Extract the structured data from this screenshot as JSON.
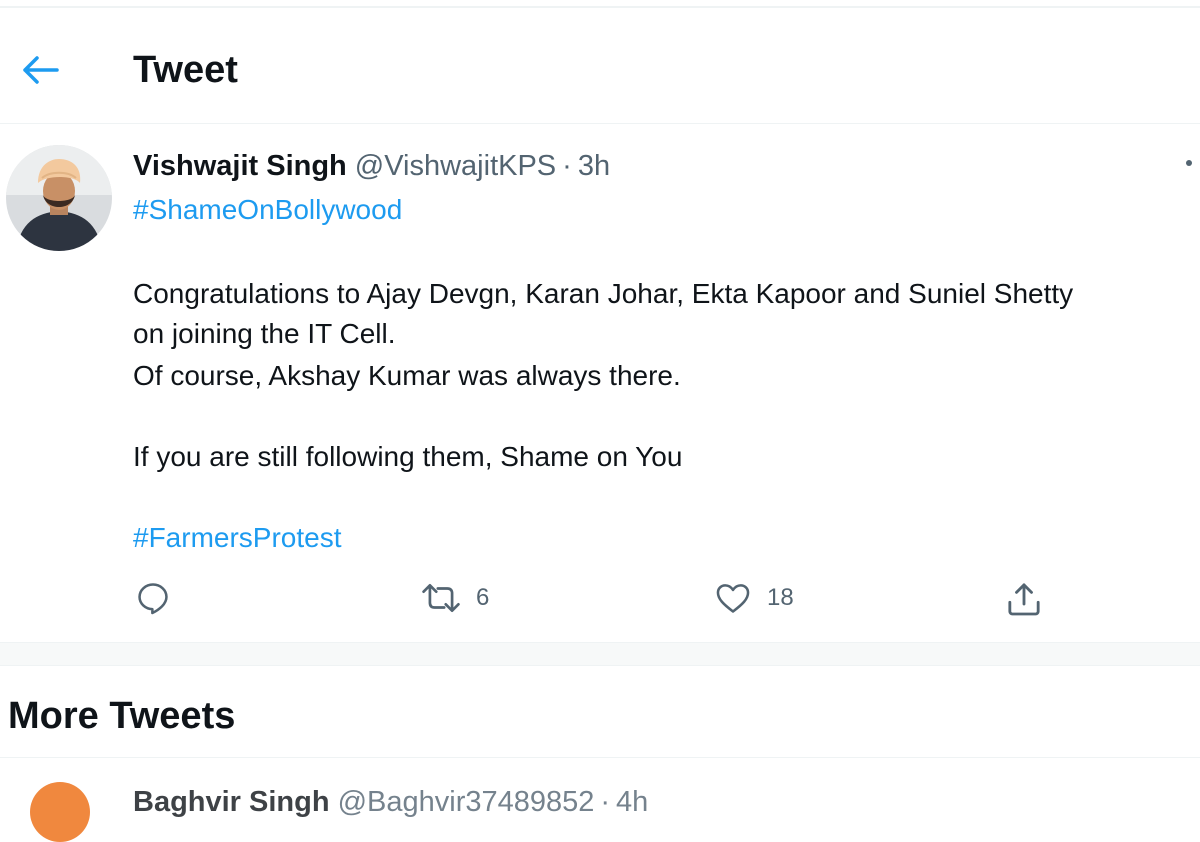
{
  "header": {
    "title": "Tweet",
    "back_icon": "arrow-left-icon"
  },
  "colors": {
    "accent": "#1d9bf0",
    "text": "#0f1419",
    "secondary": "#536471",
    "divider": "#eff3f4"
  },
  "tweet": {
    "author": {
      "display_name": "Vishwajit Singh",
      "handle": "@VishwajitKPS",
      "separator": "·",
      "time": "3h"
    },
    "lines": {
      "hashtag_top": "#ShameOnBollywood",
      "line1": "Congratulations to Ajay Devgn, Karan Johar, Ekta Kapoor and Suniel Shetty",
      "line2": "on joining the IT Cell.",
      "line3": "Of course, Akshay Kumar was always there.",
      "line4": "If you are still following them, Shame on You",
      "hashtag_bottom": "#FarmersProtest"
    },
    "actions": {
      "reply": {
        "icon": "reply-icon"
      },
      "retweet": {
        "icon": "retweet-icon",
        "count": "6"
      },
      "like": {
        "icon": "heart-icon",
        "count": "18"
      },
      "share": {
        "icon": "share-icon"
      }
    }
  },
  "more_tweets": {
    "title": "More Tweets",
    "next": {
      "display_name": "Baghvir Singh",
      "handle": "@Baghvir37489852",
      "separator": "·",
      "time": "4h"
    }
  }
}
